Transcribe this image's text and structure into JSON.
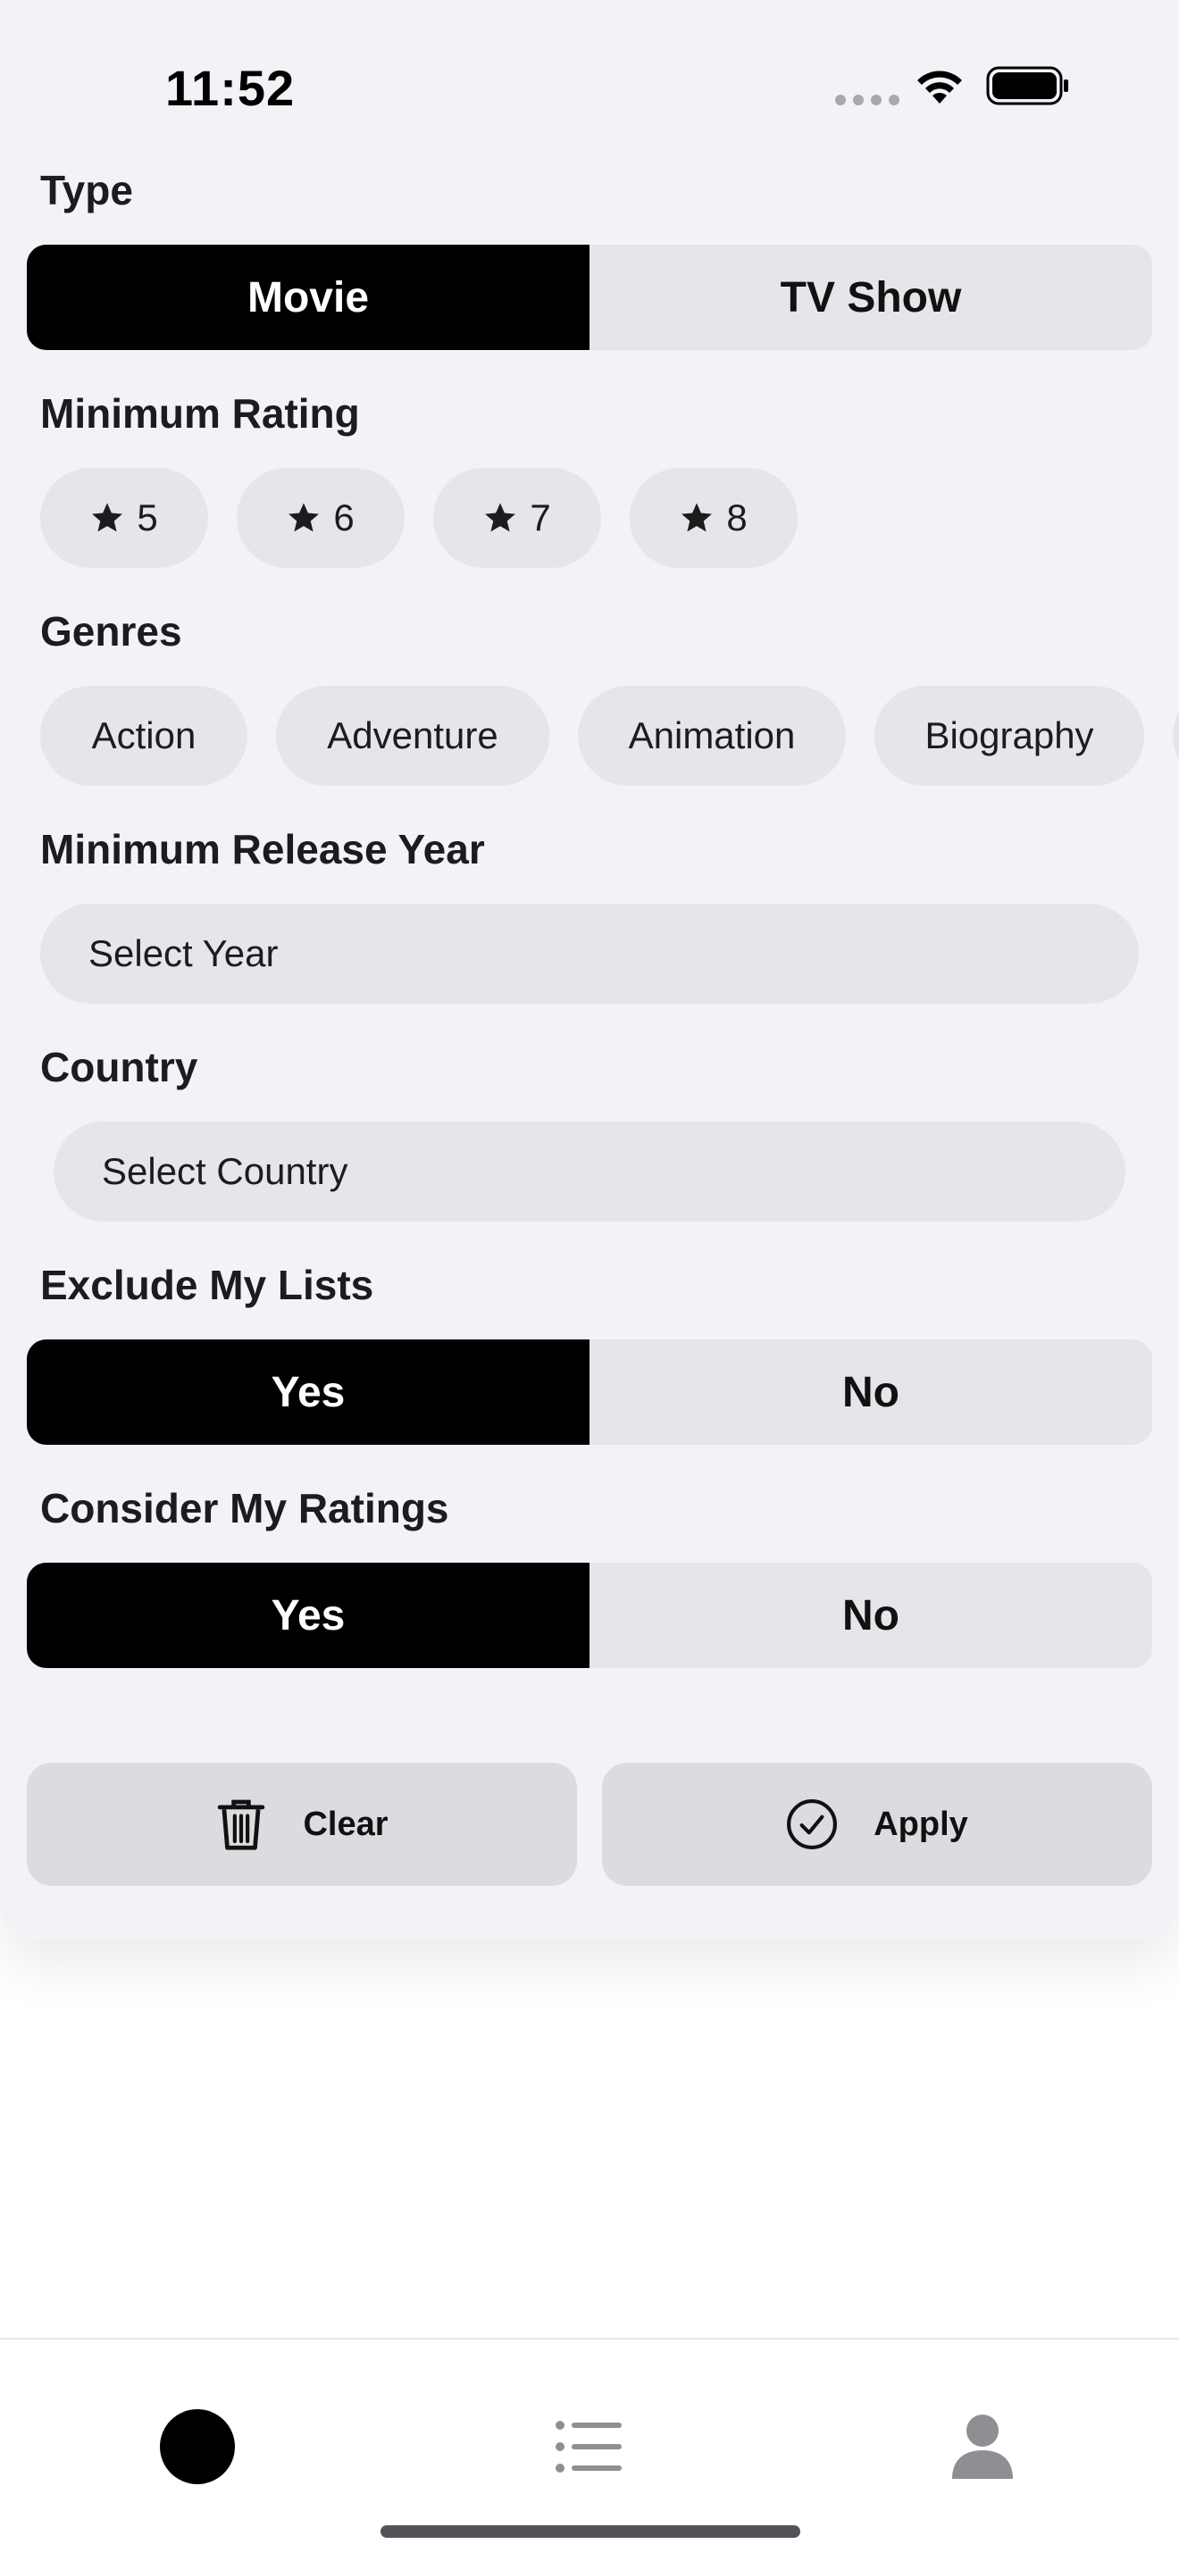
{
  "status_bar": {
    "time": "11:52"
  },
  "type": {
    "label": "Type",
    "options": [
      "Movie",
      "TV Show"
    ],
    "selected": "Movie"
  },
  "minimum_rating": {
    "label": "Minimum Rating",
    "options": [
      "5",
      "6",
      "7",
      "8"
    ]
  },
  "genres": {
    "label": "Genres",
    "options": [
      "Action",
      "Adventure",
      "Animation",
      "Biography"
    ]
  },
  "minimum_release_year": {
    "label": "Minimum Release Year",
    "placeholder": "Select Year"
  },
  "country": {
    "label": "Country",
    "placeholder": "Select Country"
  },
  "exclude_my_lists": {
    "label": "Exclude My Lists",
    "options": [
      "Yes",
      "No"
    ],
    "selected": "Yes"
  },
  "consider_my_ratings": {
    "label": "Consider My Ratings",
    "options": [
      "Yes",
      "No"
    ],
    "selected": "Yes"
  },
  "actions": {
    "clear": "Clear",
    "apply": "Apply"
  },
  "tab_bar": {
    "items": [
      {
        "icon": "circle-icon",
        "active": true
      },
      {
        "icon": "list-icon",
        "active": false
      },
      {
        "icon": "person-icon",
        "active": false
      }
    ]
  },
  "colors": {
    "active": "#000000",
    "inactive": "#e5e5ea",
    "background": "#f2f2f7",
    "tab_inactive": "#8e8e93"
  }
}
